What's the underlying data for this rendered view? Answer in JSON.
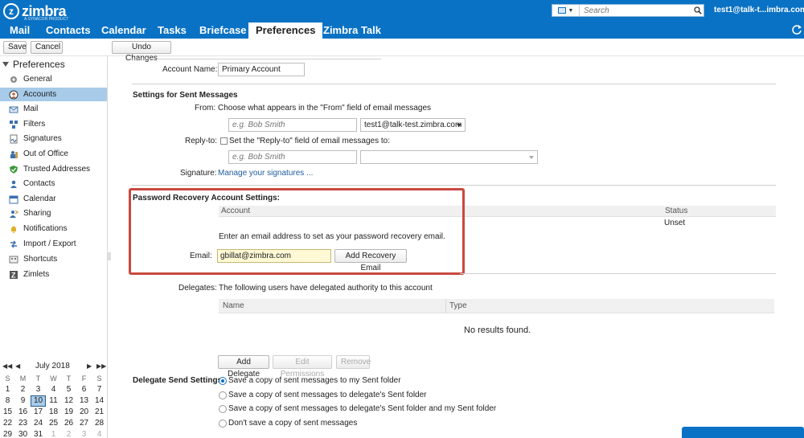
{
  "header": {
    "logo_text": "zimbra",
    "logo_sub": "A SYNACOR PRODUCT",
    "search": {
      "placeholder": "Search"
    },
    "user": "test1@talk-t...imbra.com"
  },
  "tabs": [
    {
      "label": "Mail"
    },
    {
      "label": "Contacts"
    },
    {
      "label": "Calendar"
    },
    {
      "label": "Tasks"
    },
    {
      "label": "Briefcase"
    },
    {
      "label": "Preferences"
    },
    {
      "label": "Zimbra Talk"
    }
  ],
  "toolbar": {
    "save": "Save",
    "cancel": "Cancel",
    "undo": "Undo Changes"
  },
  "sidebar": {
    "title": "Preferences",
    "items": [
      {
        "label": "General"
      },
      {
        "label": "Accounts"
      },
      {
        "label": "Mail"
      },
      {
        "label": "Filters"
      },
      {
        "label": "Signatures"
      },
      {
        "label": "Out of Office"
      },
      {
        "label": "Trusted Addresses"
      },
      {
        "label": "Contacts"
      },
      {
        "label": "Calendar"
      },
      {
        "label": "Sharing"
      },
      {
        "label": "Notifications"
      },
      {
        "label": "Import / Export"
      },
      {
        "label": "Shortcuts"
      },
      {
        "label": "Zimlets"
      }
    ]
  },
  "calendar": {
    "title": "July 2018",
    "dow": [
      "S",
      "M",
      "T",
      "W",
      "T",
      "F",
      "S"
    ],
    "weeks": [
      [
        "1",
        "2",
        "3",
        "4",
        "5",
        "6",
        "7"
      ],
      [
        "8",
        "9",
        "10",
        "11",
        "12",
        "13",
        "14"
      ],
      [
        "15",
        "16",
        "17",
        "18",
        "19",
        "20",
        "21"
      ],
      [
        "22",
        "23",
        "24",
        "25",
        "26",
        "27",
        "28"
      ],
      [
        "29",
        "30",
        "31",
        "1",
        "2",
        "3",
        "4"
      ]
    ],
    "today": "10"
  },
  "account": {
    "label": "Account Name:",
    "value": "Primary Account"
  },
  "sent": {
    "heading": "Settings for Sent Messages",
    "from_label": "From:",
    "from_desc": "Choose what appears in the \"From\" field of email messages",
    "from_name_placeholder": "e.g. Bob Smith",
    "from_address": "test1@talk-test.zimbra.com",
    "replyto_label": "Reply-to:",
    "replyto_desc": "Set the \"Reply-to\" field of email messages to:",
    "replyto_placeholder": "e.g. Bob Smith",
    "signature_label": "Signature:",
    "signature_link": "Manage your signatures ..."
  },
  "recovery": {
    "heading": "Password Recovery Account Settings:",
    "col_account": "Account",
    "col_status": "Status",
    "status_value": "Unset",
    "instructions": "Enter an email address to set as your password recovery email.",
    "email_label": "Email:",
    "email_value": "gbillat@zimbra.com",
    "add_button": "Add Recovery Email"
  },
  "delegates": {
    "label": "Delegates:",
    "desc": "The following users have delegated authority to this account",
    "col_name": "Name",
    "col_type": "Type",
    "empty": "No results found.",
    "add": "Add Delegate",
    "edit": "Edit Permissions",
    "remove": "Remove"
  },
  "delegate_send": {
    "label": "Delegate Send Settings:",
    "options": [
      "Save a copy of sent messages to my Sent folder",
      "Save a copy of sent messages to delegate's Sent folder",
      "Save a copy of sent messages to delegate's Sent folder and my Sent folder",
      "Don't save a copy of sent messages"
    ]
  },
  "colors": {
    "brand": "#0a72c4",
    "selected": "#a7cbe9",
    "highlight": "#c9493f"
  }
}
